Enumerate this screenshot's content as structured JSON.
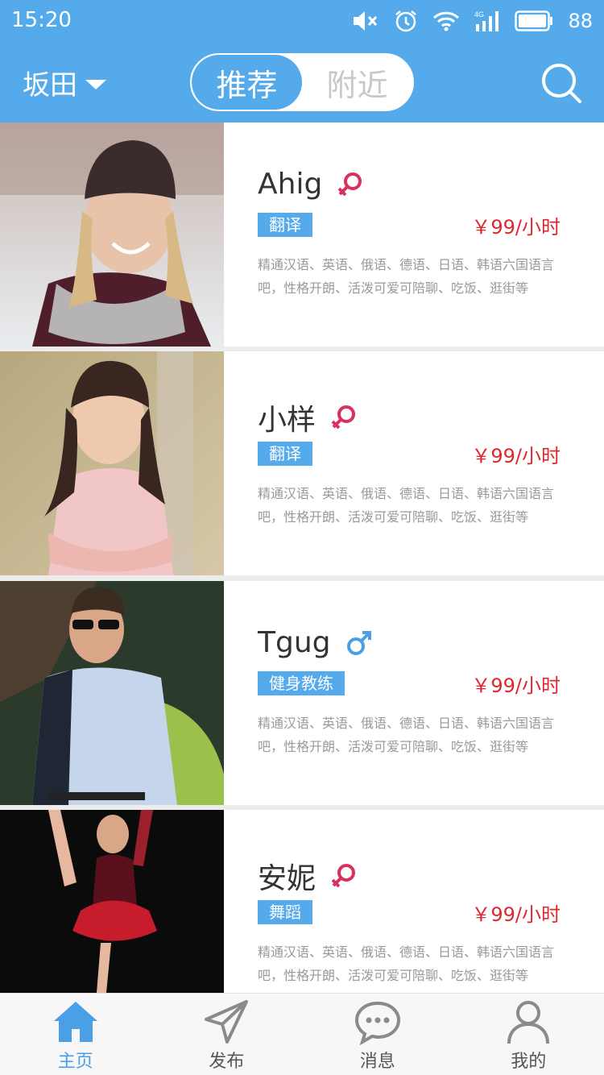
{
  "status": {
    "time": "15:20",
    "battery": "88"
  },
  "header": {
    "city": "坂田",
    "tab_recommend": "推荐",
    "tab_nearby": "附近"
  },
  "colors": {
    "primary": "#55aaec",
    "price": "#e0262f",
    "female": "#d9305c",
    "male": "#4a9fe6"
  },
  "profiles": [
    {
      "name": "Ahig",
      "gender": "female",
      "tag": "翻译",
      "price": "￥99/小时",
      "desc": "精通汉语、英语、俄语、德语、日语、韩语六国语言吧，性格开朗、活泼可爱可陪聊、吃饭、逛街等"
    },
    {
      "name": "小样",
      "gender": "female",
      "tag": "翻译",
      "price": "￥99/小时",
      "desc": "精通汉语、英语、俄语、德语、日语、韩语六国语言吧，性格开朗、活泼可爱可陪聊、吃饭、逛街等"
    },
    {
      "name": "Tgug",
      "gender": "male",
      "tag": "健身教练",
      "price": "￥99/小时",
      "desc": "精通汉语、英语、俄语、德语、日语、韩语六国语言吧，性格开朗、活泼可爱可陪聊、吃饭、逛街等"
    },
    {
      "name": "安妮",
      "gender": "female",
      "tag": "舞蹈",
      "price": "￥99/小时",
      "desc": "精通汉语、英语、俄语、德语、日语、韩语六国语言吧，性格开朗、活泼可爱可陪聊、吃饭、逛街等"
    }
  ],
  "tabs": [
    {
      "label": "主页",
      "icon": "home-icon",
      "active": true
    },
    {
      "label": "发布",
      "icon": "send-icon",
      "active": false
    },
    {
      "label": "消息",
      "icon": "message-icon",
      "active": false
    },
    {
      "label": "我的",
      "icon": "profile-icon",
      "active": false
    }
  ]
}
